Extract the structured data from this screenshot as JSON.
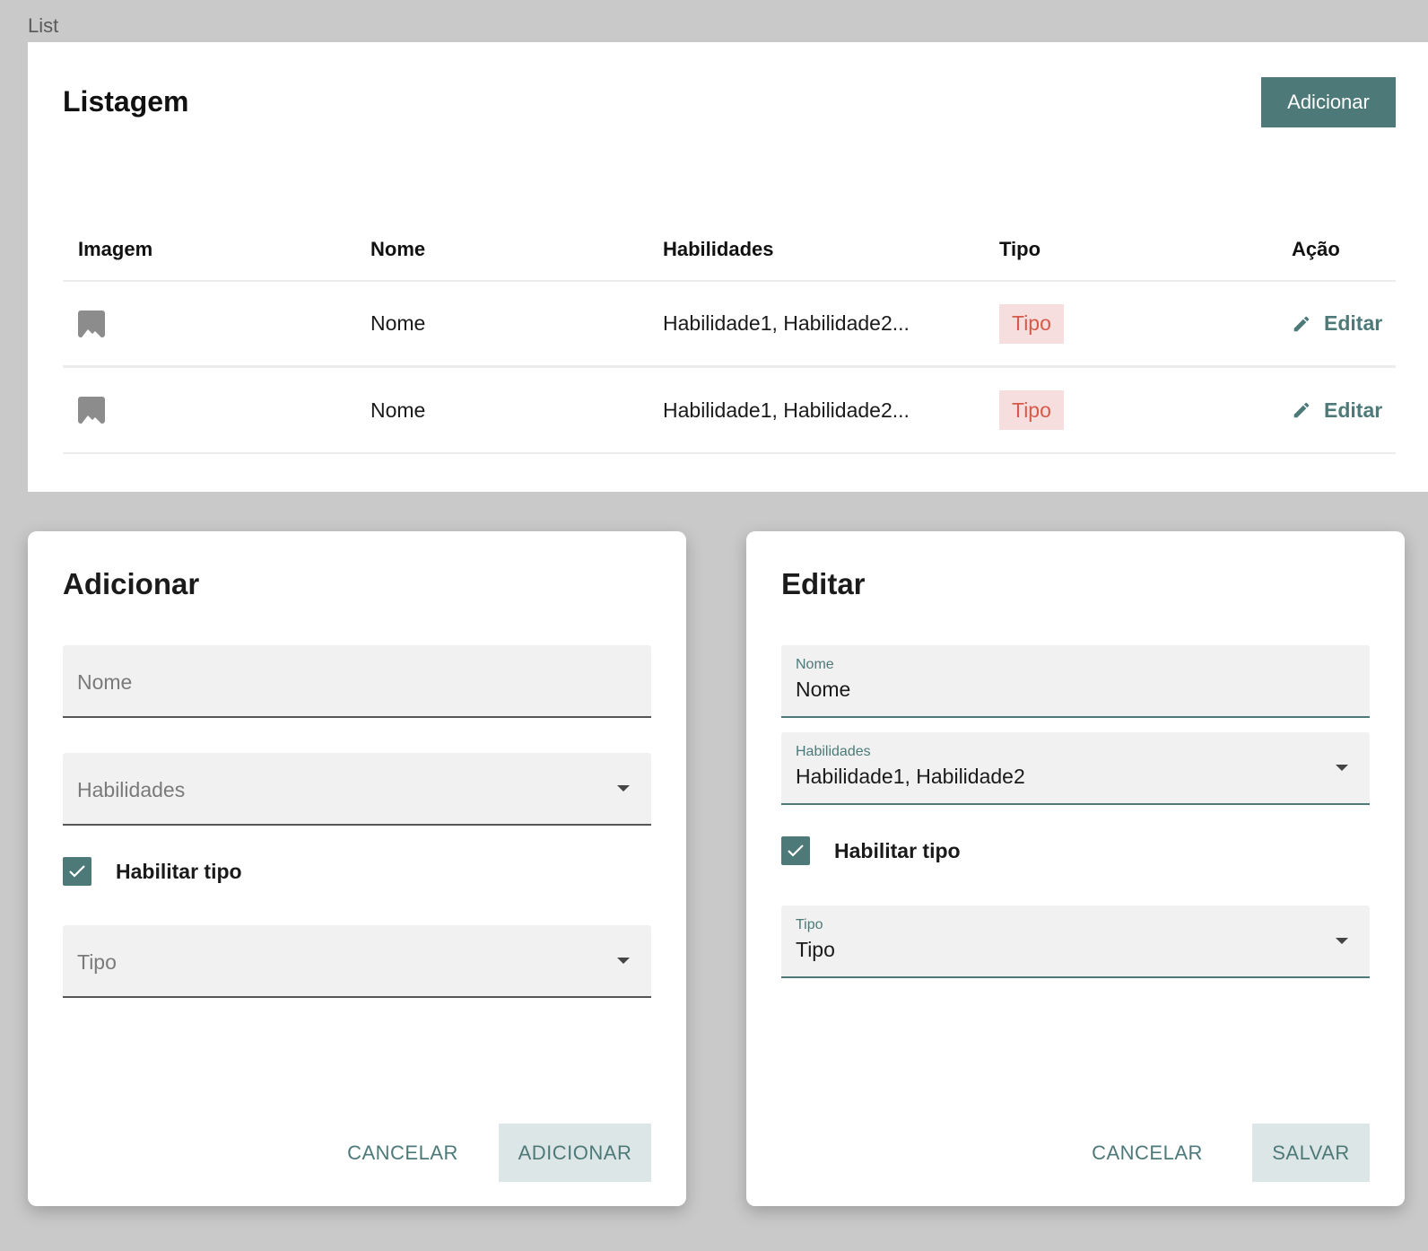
{
  "frame": {
    "label": "List"
  },
  "list": {
    "title": "Listagem",
    "add_button": "Adicionar",
    "columns": [
      "Imagem",
      "Nome",
      "Habilidades",
      "Tipo",
      "Ação"
    ],
    "rows": [
      {
        "image_icon": "image-icon",
        "nome": "Nome",
        "habilidades": "Habilidade1, Habilidade2...",
        "tipo": "Tipo",
        "action_label": "Editar",
        "action_icon": "pencil-icon"
      },
      {
        "image_icon": "image-icon",
        "nome": "Nome",
        "habilidades": "Habilidade1, Habilidade2...",
        "tipo": "Tipo",
        "action_label": "Editar",
        "action_icon": "pencil-icon"
      }
    ]
  },
  "add_dialog": {
    "title": "Adicionar",
    "nome_placeholder": "Nome",
    "habilidades_placeholder": "Habilidades",
    "checkbox_label": "Habilitar tipo",
    "checkbox_checked": true,
    "tipo_placeholder": "Tipo",
    "cancel_label": "CANCELAR",
    "submit_label": "ADICIONAR"
  },
  "edit_dialog": {
    "title": "Editar",
    "nome_label": "Nome",
    "nome_value": "Nome",
    "habilidades_label": "Habilidades",
    "habilidades_value": "Habilidade1, Habilidade2",
    "checkbox_label": "Habilitar tipo",
    "checkbox_checked": true,
    "tipo_label": "Tipo",
    "tipo_value": "Tipo",
    "cancel_label": "CANCELAR",
    "submit_label": "SALVAR"
  },
  "colors": {
    "accent": "#4d7a78",
    "badge_bg": "#f7dede",
    "badge_text": "#d65a4a",
    "background": "#c9c9c9"
  }
}
